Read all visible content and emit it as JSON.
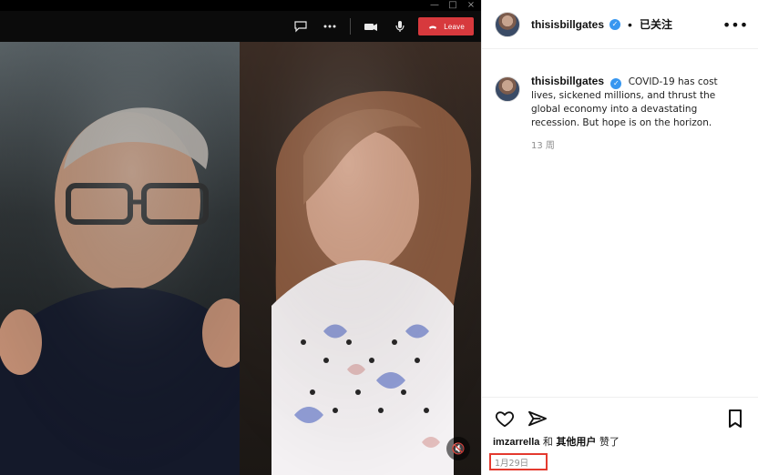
{
  "window_controls": {
    "minimize": "—",
    "maximize": "□",
    "close": "×"
  },
  "video_call": {
    "toolbar": {
      "leave_label": "Leave"
    }
  },
  "instagram": {
    "post": {
      "username": "thisisbillgates",
      "follow_state": "已关注",
      "caption_lines": [
        "COVID-19 has cost",
        "lives, sickened millions, and thrust the",
        "global economy into a devastating",
        "recession. But hope is on the horizon."
      ],
      "caption_age": "13 周",
      "likes": {
        "liker_username": "imzarrella",
        "conjunction": "和",
        "others_text": "其他用户",
        "suffix": "赞了"
      },
      "date": "1月29日"
    }
  },
  "colors": {
    "leave_red": "#d7393d",
    "verified_blue": "#3897f0",
    "date_highlight_red": "#e43a2f"
  },
  "icons": {
    "chat": "chat-icon",
    "more": "more-icon",
    "camera": "camera-icon",
    "microphone": "microphone-icon",
    "phone": "phone-icon",
    "mute": "mute-icon",
    "heart": "heart-icon",
    "send": "send-icon",
    "bookmark": "bookmark-icon"
  }
}
